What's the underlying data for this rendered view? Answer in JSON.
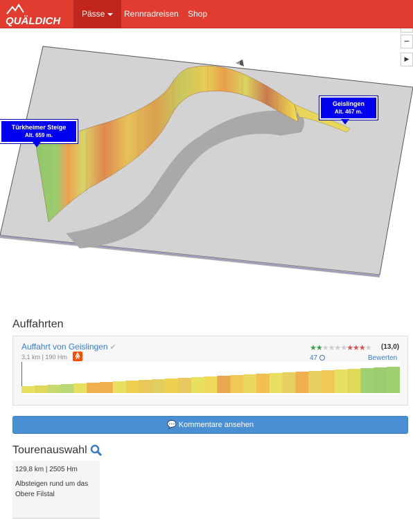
{
  "navbar": {
    "logo_text": "QUÄLDICH",
    "items": [
      {
        "label": "Pässe",
        "active": true,
        "has_caret": true
      },
      {
        "label": "Rennradreisen"
      },
      {
        "label": "Shop"
      }
    ],
    "brand_color": "#e23c31"
  },
  "map": {
    "zoom_in_icon": "plus-icon",
    "zoom_out_icon": "minus-icon",
    "play_icon": "play-icon",
    "compass_label": "N",
    "markers": [
      {
        "name": "Türkheimer Steige",
        "altitude": "Alt. 659 m."
      },
      {
        "name": "Geislingen",
        "altitude": "Alt. 467 m."
      }
    ]
  },
  "auffahrten": {
    "heading": "Auffahrten",
    "climb": {
      "title": "Auffahrt von Geislingen",
      "stats": "3,1 km | 190 Hm",
      "rating_green_stars": 2,
      "rating_red_stars": 3,
      "rating_total": 10,
      "rating_score": "(13,0)",
      "votes": "47",
      "rate_label": "Bewerten"
    }
  },
  "comments_button": "Kommentare ansehen",
  "tourenauswahl": {
    "heading": "Tourenauswahl",
    "tour": {
      "stats": "129,8 km | 2505 Hm",
      "name": "Albsteigen rund um das Obere Filstal"
    }
  }
}
